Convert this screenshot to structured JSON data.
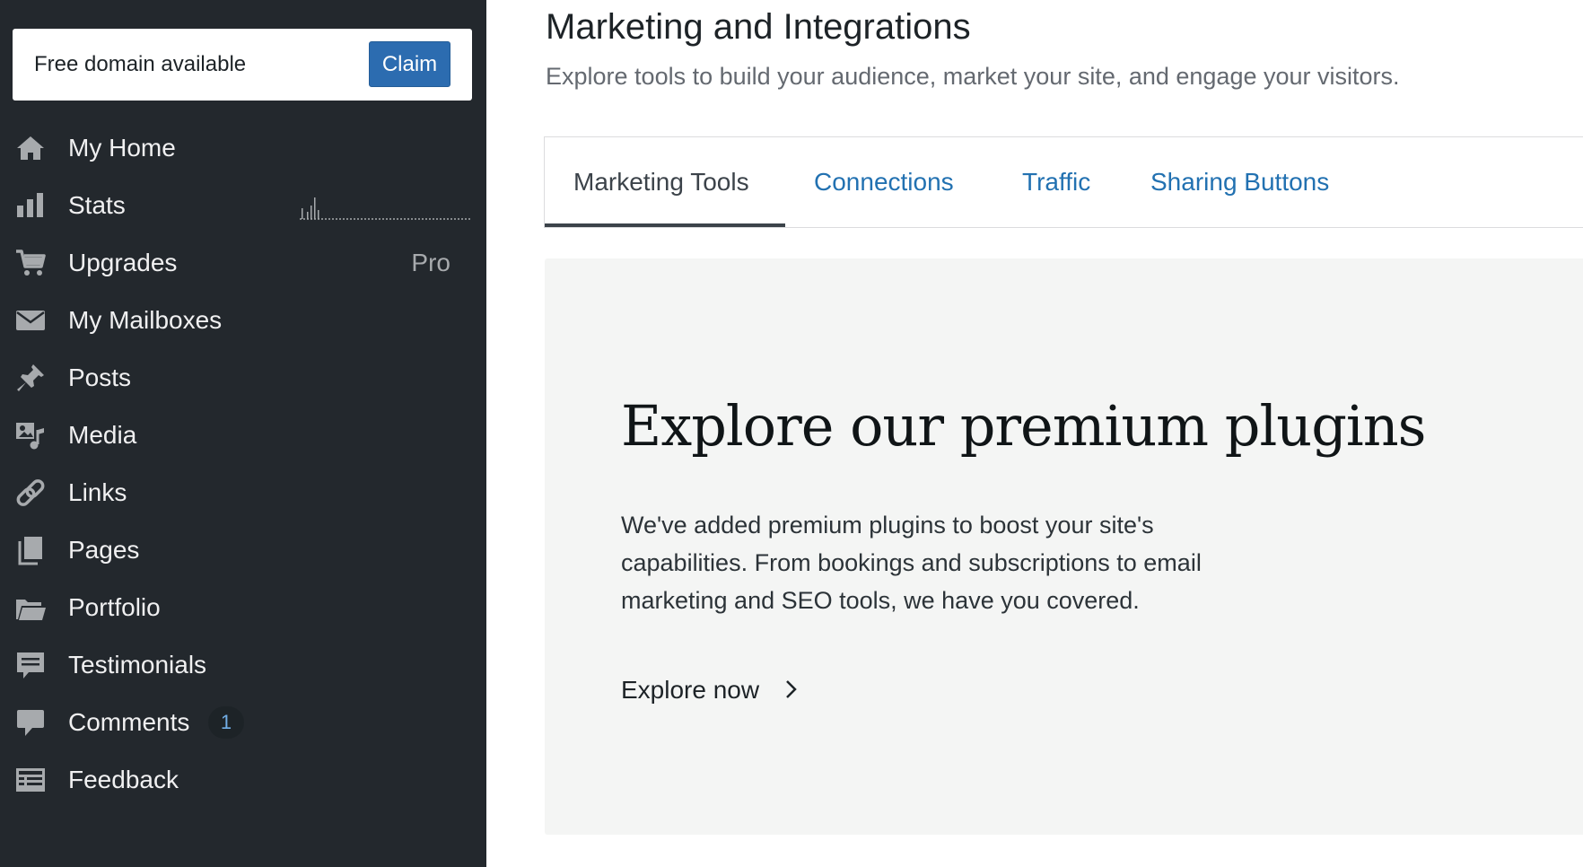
{
  "sidebar": {
    "domain_card": {
      "text": "Free domain available",
      "claim_label": "Claim"
    },
    "items": [
      {
        "label": "My Home",
        "icon": "home-icon"
      },
      {
        "label": "Stats",
        "icon": "stats-icon"
      },
      {
        "label": "Upgrades",
        "icon": "cart-icon",
        "badge": "Pro"
      },
      {
        "label": "My Mailboxes",
        "icon": "mail-icon"
      },
      {
        "label": "Posts",
        "icon": "pin-icon"
      },
      {
        "label": "Media",
        "icon": "media-icon"
      },
      {
        "label": "Links",
        "icon": "link-icon"
      },
      {
        "label": "Pages",
        "icon": "pages-icon"
      },
      {
        "label": "Portfolio",
        "icon": "folder-icon"
      },
      {
        "label": "Testimonials",
        "icon": "testimonial-icon"
      },
      {
        "label": "Comments",
        "icon": "comment-icon",
        "count": "1"
      },
      {
        "label": "Feedback",
        "icon": "feedback-icon"
      }
    ]
  },
  "main": {
    "title": "Marketing and Integrations",
    "subtitle": "Explore tools to build your audience, market your site, and engage your visitors.",
    "tabs": [
      {
        "label": "Marketing Tools",
        "active": true
      },
      {
        "label": "Connections",
        "active": false
      },
      {
        "label": "Traffic",
        "active": false
      },
      {
        "label": "Sharing Buttons",
        "active": false
      }
    ],
    "promo": {
      "title": "Explore our premium plugins",
      "body": "We've added premium plugins to boost your site's capabilities. From bookings and subscriptions to email marketing and SEO tools, we have you covered.",
      "link_label": "Explore now"
    }
  },
  "colors": {
    "sidebar_bg": "#23282d",
    "accent": "#2271b1",
    "claim_button": "#2c6cb0",
    "promo_bg": "#f4f5f4"
  }
}
